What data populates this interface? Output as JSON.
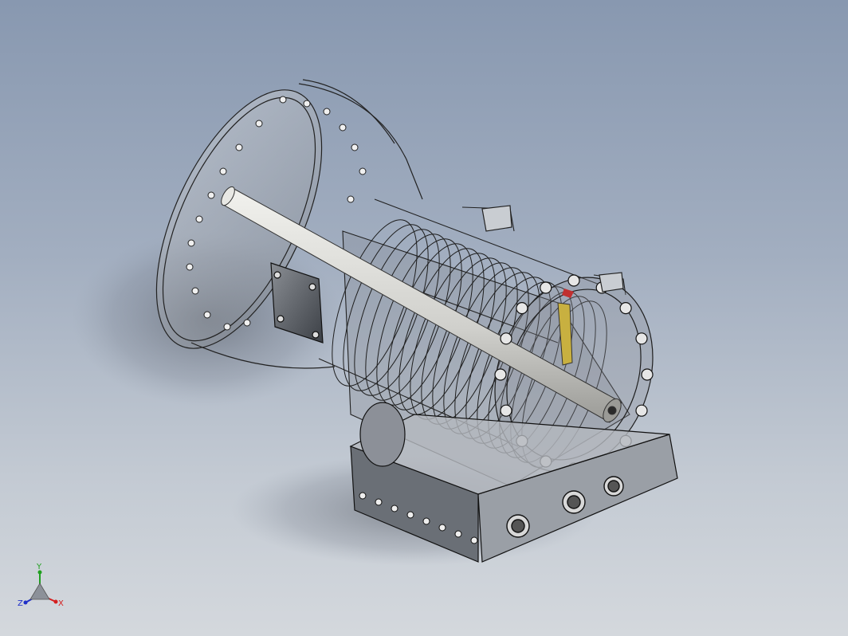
{
  "viewport": {
    "background_top": "#8898b0",
    "background_bottom": "#d4d8dd",
    "model_name": ""
  },
  "triad": {
    "x_label": "X",
    "y_label": "Y",
    "z_label": "Z",
    "x_color": "#d42020",
    "y_color": "#20a020",
    "z_color": "#2030c8"
  },
  "model": {
    "description_icon": "transmission-assembly-icon",
    "line_color": "#2a2a2a",
    "shaft_color": "#dcdcd8",
    "highlight_part_color": "#c8b040",
    "highlight_red_color": "#c03030"
  }
}
